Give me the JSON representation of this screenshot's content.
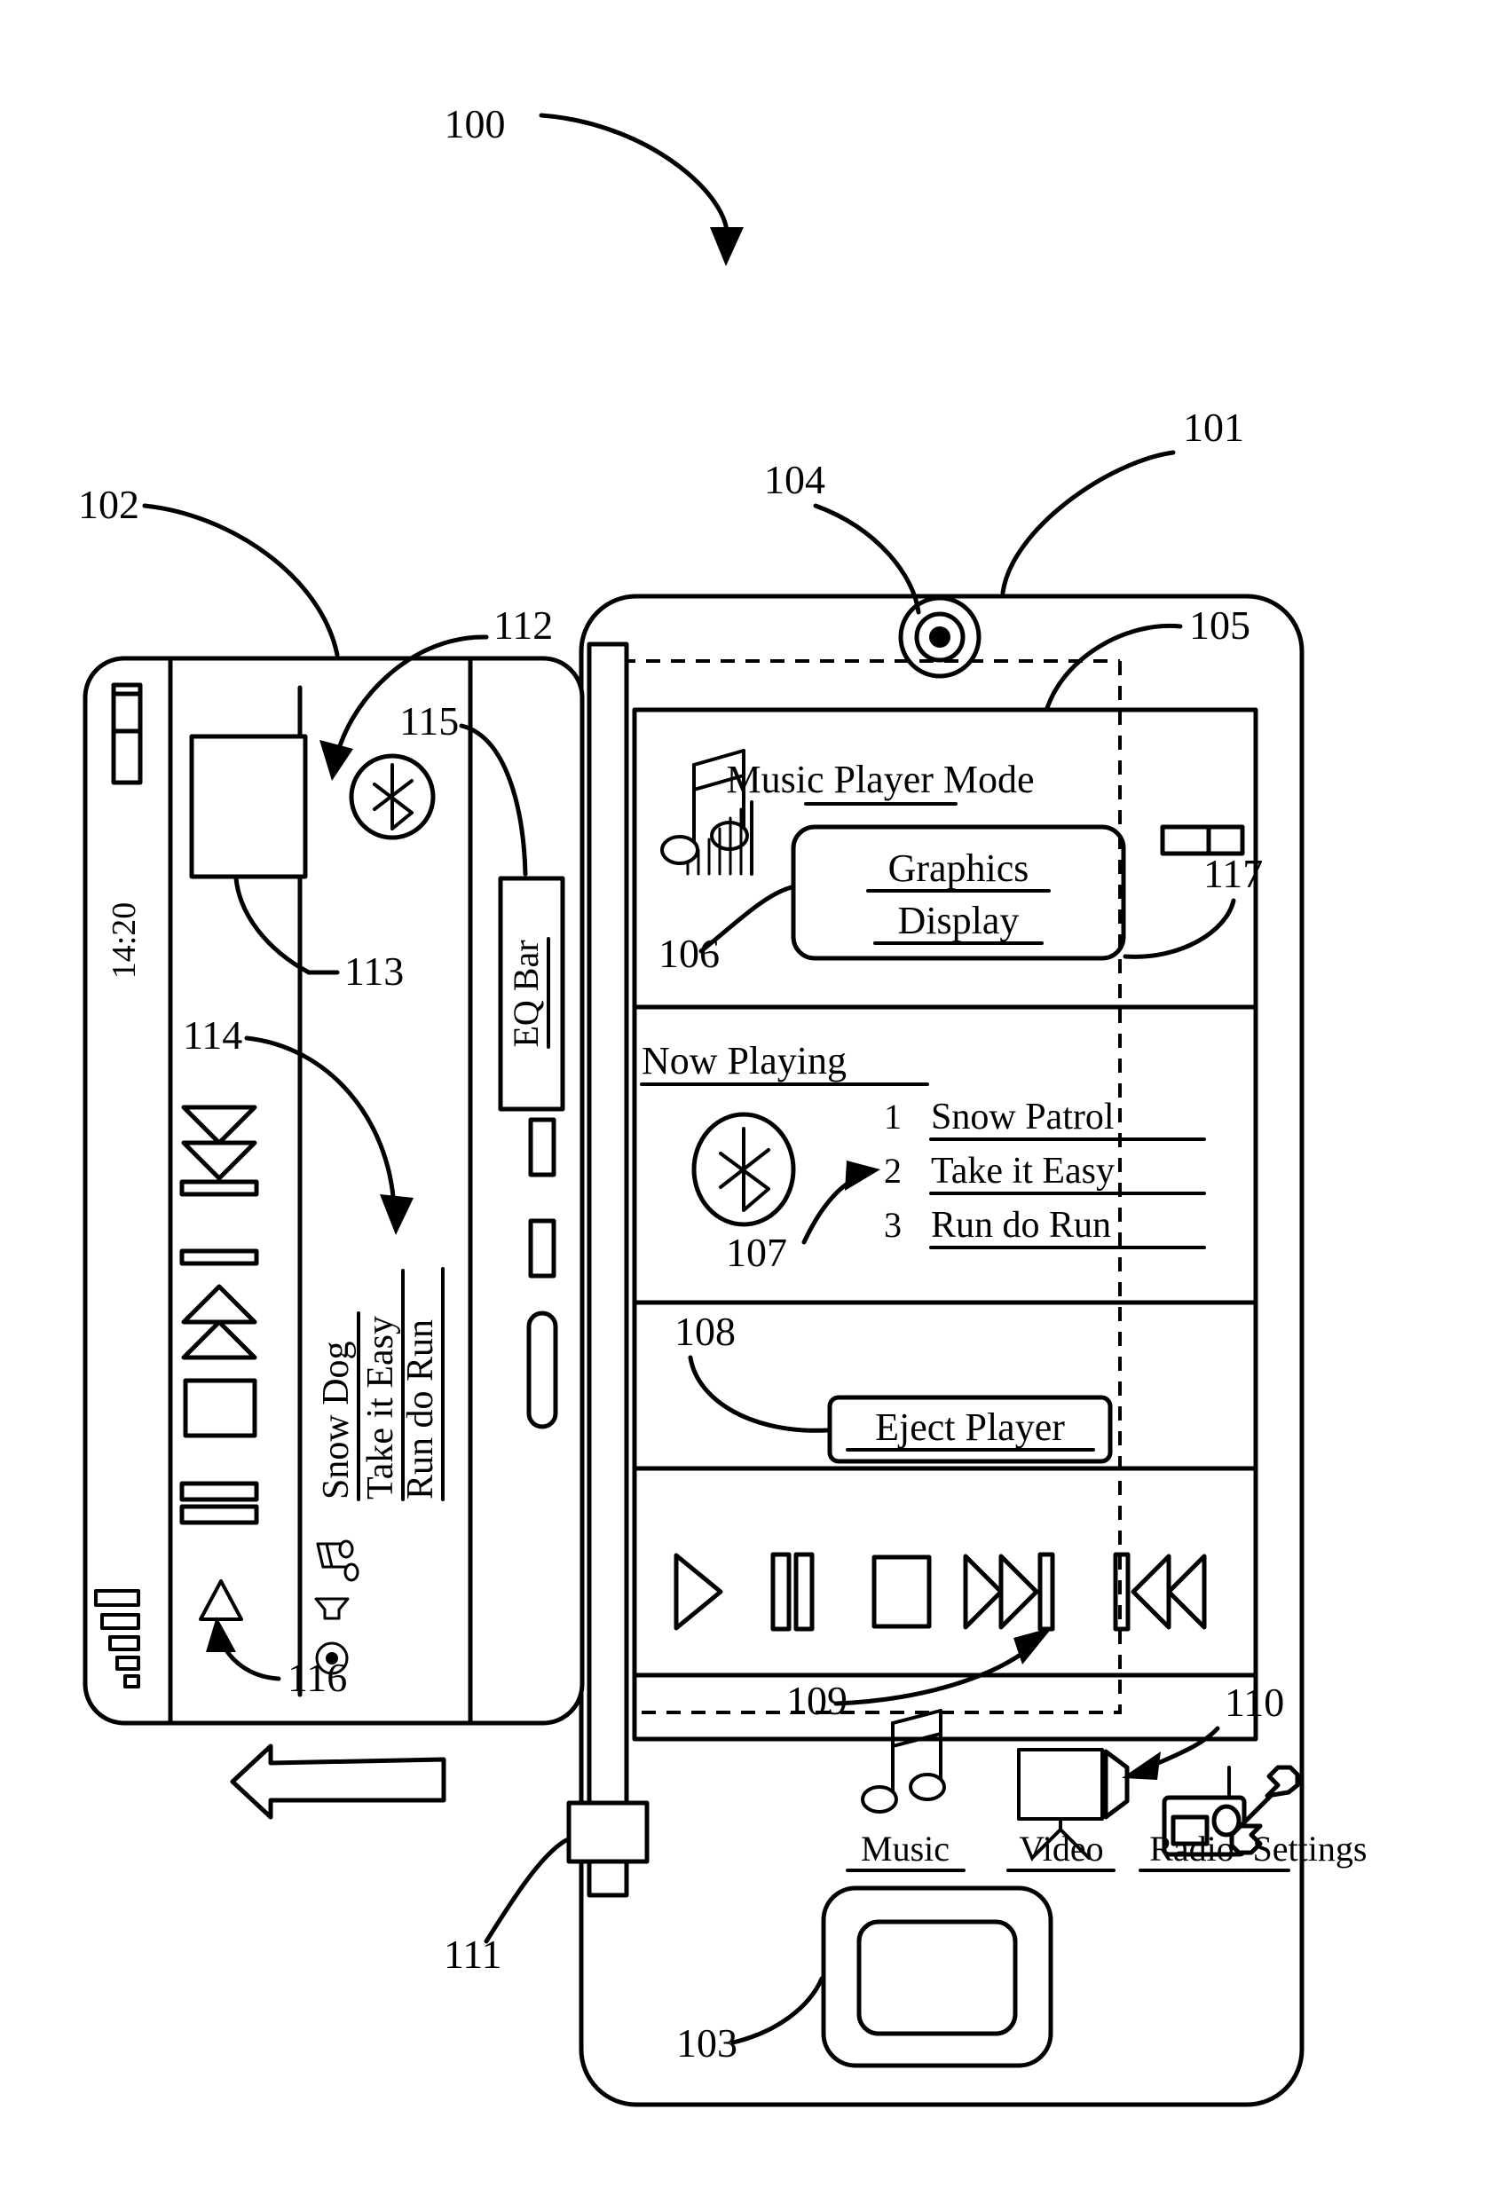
{
  "figure": {
    "label": "100",
    "reference_numerals": {
      "figure": "100",
      "phone_device": "101",
      "accessory_device": "102",
      "home_button": "103",
      "earpiece_speaker": "104",
      "screen": "105",
      "equalizer_visualizer": "106",
      "bluetooth_indicator": "107",
      "eject_player_control": "108",
      "transport_controls": "109",
      "settings_nav_item": "110",
      "dock_connector": "111",
      "accessory_bluetooth_icon": "112",
      "accessory_graphics_box": "113",
      "accessory_track_list": "114",
      "accessory_eq_bar": "115",
      "accessory_play_button": "116",
      "battery_indicator": "117"
    }
  },
  "phone": {
    "screen": {
      "mode_title": "Music Player Mode",
      "graphics_display": {
        "line1": "Graphics",
        "line2": "Display"
      },
      "now_playing": {
        "heading": "Now Playing",
        "tracks": [
          {
            "number": "1",
            "title": "Snow Patrol"
          },
          {
            "number": "2",
            "title": "Take it Easy"
          },
          {
            "number": "3",
            "title": "Run do Run"
          }
        ]
      },
      "eject_button_label": "Eject Player",
      "transport": [
        {
          "name": "play",
          "glyph": "play-icon"
        },
        {
          "name": "pause",
          "glyph": "pause-icon"
        },
        {
          "name": "stop",
          "glyph": "stop-icon"
        },
        {
          "name": "next",
          "glyph": "next-track-icon"
        },
        {
          "name": "previous",
          "glyph": "previous-track-icon"
        }
      ],
      "nav_items": [
        {
          "label": "Music",
          "icon": "music-note-icon"
        },
        {
          "label": "Video",
          "icon": "video-camera-icon"
        },
        {
          "label": "Radio",
          "icon": "radio-icon"
        },
        {
          "label": "Settings",
          "icon": "wrench-icon"
        }
      ]
    }
  },
  "accessory": {
    "status": {
      "time": "14:20",
      "signal_icon": "signal-bars-icon",
      "battery_icon": "battery-icon"
    },
    "eq_bar_label": "EQ Bar",
    "track_list": [
      "Snow Dog",
      "Take it Easy",
      "Run do Run"
    ],
    "small_icons": [
      "music-note-icon",
      "speaker-icon",
      "record-icon"
    ],
    "transport_icons": [
      "previous-track-icon",
      "next-track-icon",
      "stop-icon",
      "pause-icon",
      "play-icon"
    ]
  }
}
